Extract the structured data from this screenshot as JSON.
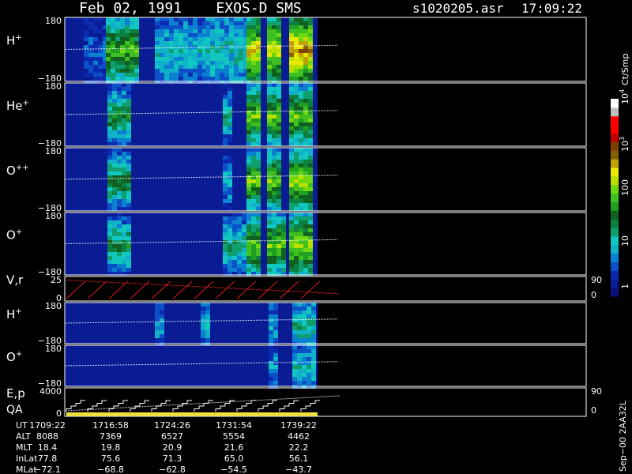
{
  "header": {
    "title": "Feb 02, 1991    EXOS-D SMS",
    "file": "s1020205.asr",
    "time": "17:09:22"
  },
  "colorbar": {
    "unit": "Ct/Smp",
    "ticks": [
      {
        "label": "1",
        "sup": "",
        "value": 1
      },
      {
        "label": "10",
        "sup": "",
        "value": 10
      },
      {
        "label": "100",
        "sup": "",
        "value": 100
      },
      {
        "label": "10",
        "sup": "3",
        "value": 1000
      },
      {
        "label": "10",
        "sup": "4",
        "value": 10000
      }
    ],
    "colors": [
      "#08107a",
      "#0a1c94",
      "#0c2ab0",
      "#0c50c8",
      "#0a80d0",
      "#10b0c8",
      "#10c8c0",
      "#10a070",
      "#0c8040",
      "#106020",
      "#20a020",
      "#40c020",
      "#70d810",
      "#b8e000",
      "#e8e800",
      "#c0a000",
      "#806000",
      "#804000",
      "#c00000",
      "#ff0000",
      "#ff0000",
      "#c0c0c0",
      "#ffffff"
    ]
  },
  "panels": [
    {
      "id": "hplus",
      "label": "H",
      "sup": "+",
      "ymax": "180",
      "ymin": "−180",
      "right_ticks": []
    },
    {
      "id": "heplus",
      "label": "He",
      "sup": "+",
      "ymax": "180",
      "ymin": "−180",
      "right_ticks": []
    },
    {
      "id": "oplusplus",
      "label": "O",
      "sup": "++",
      "ymax": "180",
      "ymin": "−180",
      "right_ticks": []
    },
    {
      "id": "oplus",
      "label": "O",
      "sup": "+",
      "ymax": "180",
      "ymin": "−180",
      "right_ticks": []
    },
    {
      "id": "vr",
      "label": "V,r",
      "sup": "",
      "ymax": "25",
      "ymin": "0",
      "right_ticks": [
        "90",
        "0"
      ]
    },
    {
      "id": "hplus2",
      "label": "H",
      "sup": "+",
      "ymax": "180",
      "ymin": "−180",
      "right_ticks": []
    },
    {
      "id": "oplus2",
      "label": "O",
      "sup": "+",
      "ymax": "180",
      "ymin": "−180",
      "right_ticks": []
    },
    {
      "id": "ep",
      "label": "E,p",
      "sup": "",
      "label2": "QA",
      "ymax": "4000",
      "ymin": "0",
      "right_ticks": [
        "90",
        "0"
      ]
    }
  ],
  "footer": {
    "rows": [
      {
        "name": "UT",
        "values": [
          "1709:22",
          "1716:58",
          "1724:26",
          "1731:54",
          "1739:22"
        ]
      },
      {
        "name": "ALT",
        "values": [
          "8088",
          "7369",
          "6527",
          "5554",
          "4462"
        ]
      },
      {
        "name": "MLT",
        "values": [
          "18.4",
          "19.8",
          "20.9",
          "21.6",
          "22.2"
        ]
      },
      {
        "name": "InLat",
        "values": [
          "77.8",
          "75.6",
          "71.3",
          "65.0",
          "56.1"
        ]
      },
      {
        "name": "MLat",
        "values": [
          "−72.1",
          "−68.8",
          "−62.8",
          "−54.5",
          "−43.7"
        ]
      }
    ]
  },
  "side_note": "Sep−00 2AA32L",
  "chart_data": {
    "type": "heatmap",
    "title": "Feb 02, 1991    EXOS-D SMS",
    "x": [
      "1709:22",
      "1716:58",
      "1724:26",
      "1731:54",
      "1739:22"
    ],
    "series": [
      {
        "name": "H+",
        "ylim": [
          -180,
          180
        ]
      },
      {
        "name": "He+",
        "ylim": [
          -180,
          180
        ]
      },
      {
        "name": "O++",
        "ylim": [
          -180,
          180
        ]
      },
      {
        "name": "O+",
        "ylim": [
          -180,
          180
        ]
      },
      {
        "name": "V,r",
        "ylim": [
          0,
          25
        ]
      },
      {
        "name": "H+",
        "ylim": [
          -180,
          180
        ]
      },
      {
        "name": "O+",
        "ylim": [
          -180,
          180
        ]
      },
      {
        "name": "E,p",
        "ylim": [
          0,
          4000
        ]
      }
    ],
    "color_scale": {
      "label": "Ct/Smp",
      "range": [
        1,
        10000
      ],
      "log": true
    }
  }
}
